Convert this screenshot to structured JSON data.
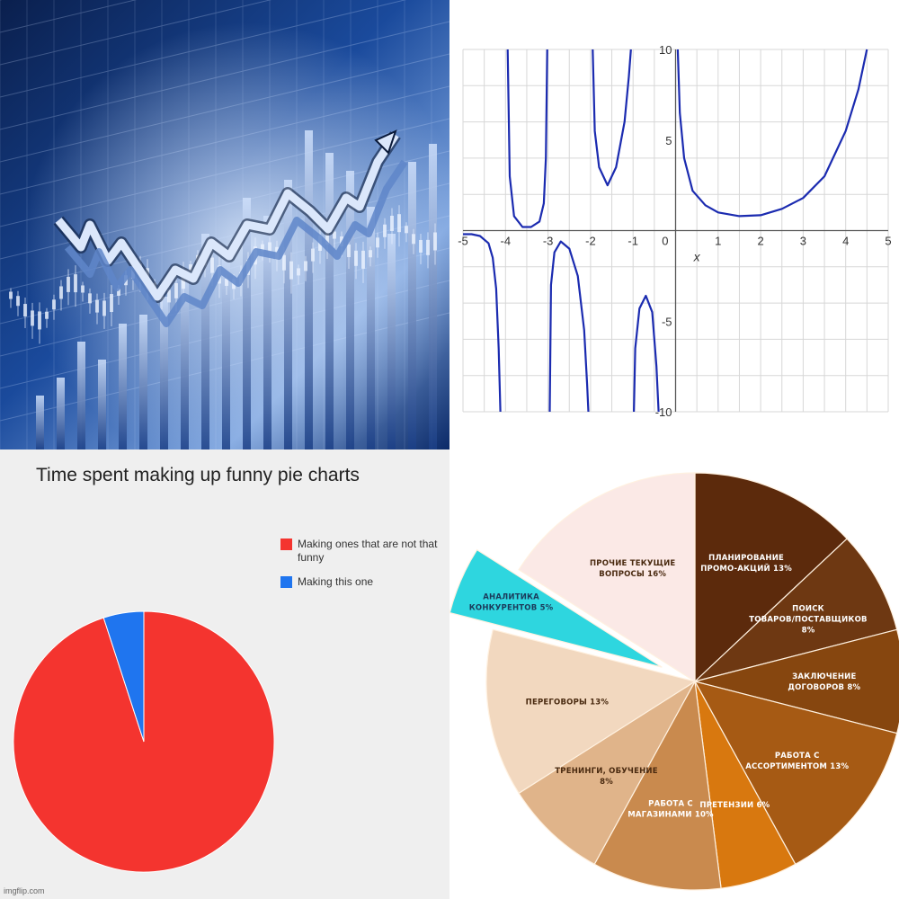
{
  "stock_image": {
    "colors": {
      "bg_dark": "#0a1f4d",
      "bg_mid": "#1a4a9c",
      "bg_light": "#c9dbf5",
      "line": "#e8f0ff"
    },
    "icons": [
      "rising-arrow-icon"
    ]
  },
  "chart_data": [
    {
      "type": "line",
      "title": "",
      "xlabel": "x",
      "ylabel": "",
      "xlim": [
        -5,
        5
      ],
      "ylim": [
        -10,
        10
      ],
      "x_ticks": [
        -5,
        -4,
        -3,
        -2,
        -1,
        1,
        2,
        3,
        4,
        5
      ],
      "x_tick_labels": [
        "-5",
        "-4",
        "-3",
        "-2",
        "-1",
        "1",
        "2",
        "3",
        "4",
        "5"
      ],
      "origin_label": "0",
      "y_ticks": [
        10,
        5,
        -5,
        -10
      ],
      "y_tick_labels": [
        "10",
        "5",
        "-5",
        "-10"
      ],
      "grid": true,
      "color": "#1b2bb0",
      "series": [
        {
          "branches": [
            {
              "x": [
                -5,
                -4.8,
                -4.6,
                -4.4,
                -4.3,
                -4.22,
                -4.16,
                -4.12
              ],
              "y": [
                -0.2,
                -0.2,
                -0.3,
                -0.7,
                -1.5,
                -3.2,
                -6.5,
                -10
              ]
            },
            {
              "x": [
                -3.95,
                -3.9,
                -3.8,
                -3.6,
                -3.4,
                -3.2,
                -3.1,
                -3.05,
                -3.02
              ],
              "y": [
                10,
                3.0,
                0.8,
                0.2,
                0.2,
                0.5,
                1.5,
                4.0,
                10
              ]
            },
            {
              "x": [
                -2.96,
                -2.93,
                -2.85,
                -2.7,
                -2.5,
                -2.3,
                -2.15,
                -2.08,
                -2.05
              ],
              "y": [
                -10,
                -3.0,
                -1.2,
                -0.6,
                -1.0,
                -2.5,
                -5.5,
                -8.5,
                -10
              ]
            },
            {
              "x": [
                -1.95,
                -1.9,
                -1.8,
                -1.6,
                -1.4,
                -1.2,
                -1.1,
                -1.05
              ],
              "y": [
                10,
                5.5,
                3.5,
                2.5,
                3.5,
                6.0,
                8.5,
                10
              ]
            },
            {
              "x": [
                -0.98,
                -0.95,
                -0.85,
                -0.7,
                -0.55,
                -0.45,
                -0.4
              ],
              "y": [
                -10,
                -6.5,
                -4.3,
                -3.6,
                -4.5,
                -7.5,
                -10
              ]
            },
            {
              "x": [
                0.05,
                0.1,
                0.2,
                0.4,
                0.7,
                1.0,
                1.5,
                2.0,
                2.5,
                3.0,
                3.5,
                4.0,
                4.3,
                4.5
              ],
              "y": [
                10,
                6.5,
                4.0,
                2.2,
                1.4,
                1.0,
                0.8,
                0.85,
                1.2,
                1.8,
                3.0,
                5.5,
                7.8,
                10
              ]
            }
          ]
        }
      ]
    },
    {
      "type": "pie",
      "title": "Time spent making up funny pie charts",
      "legend_position": "right",
      "series": [
        {
          "name": "Making ones that are not that funny",
          "value": 95,
          "color": "#f4342f"
        },
        {
          "name": "Making this one",
          "value": 5,
          "color": "#1f75ef"
        }
      ],
      "watermark": "imgflip.com"
    },
    {
      "type": "pie",
      "title": "",
      "slices": [
        {
          "label_lines": [
            "ПЛАНИРОВАНИЕ",
            "ПРОМО-АКЦИЙ 13%"
          ],
          "value": 13,
          "color": "#5c2a0c",
          "text_color": "#ffffff"
        },
        {
          "label_lines": [
            "ПОИСК",
            "ТОВАРОВ/ПОСТАВЩИКОВ",
            "8%"
          ],
          "value": 8,
          "color": "#6e3812",
          "text_color": "#ffffff"
        },
        {
          "label_lines": [
            "ЗАКЛЮЧЕНИЕ",
            "ДОГОВОРОВ 8%"
          ],
          "value": 8,
          "color": "#86460f",
          "text_color": "#ffffff"
        },
        {
          "label_lines": [
            "РАБОТА С",
            "АССОРТИМЕНТОМ 13%"
          ],
          "value": 13,
          "color": "#a65a14",
          "text_color": "#ffffff"
        },
        {
          "label_lines": [
            "ПРЕТЕНЗИИ 6%"
          ],
          "value": 6,
          "color": "#d8780f",
          "text_color": "#ffffff"
        },
        {
          "label_lines": [
            "РАБОТА С",
            "МАГАЗИНАМИ 10%"
          ],
          "value": 10,
          "color": "#c98a4e",
          "text_color": "#ffffff"
        },
        {
          "label_lines": [
            "ТРЕНИНГИ, ОБУЧЕНИЕ",
            "8%"
          ],
          "value": 8,
          "color": "#e0b48a",
          "text_color": "#4a2a10"
        },
        {
          "label_lines": [
            "ПЕРЕГОВОРЫ 13%"
          ],
          "value": 13,
          "color": "#f2d8bf",
          "text_color": "#4a2a10"
        },
        {
          "label_lines": [
            "АНАЛИТИКА",
            "КОНКУРЕНТОВ 5%"
          ],
          "value": 5,
          "color": "#2ed6df",
          "text_color": "#1b3a5a",
          "exploded": true
        },
        {
          "label_lines": [
            "ПРОЧИЕ ТЕКУЩИЕ",
            "ВОПРОСЫ 16%"
          ],
          "value": 16,
          "color": "#fbe9e6",
          "text_color": "#4a2a10"
        }
      ]
    }
  ]
}
